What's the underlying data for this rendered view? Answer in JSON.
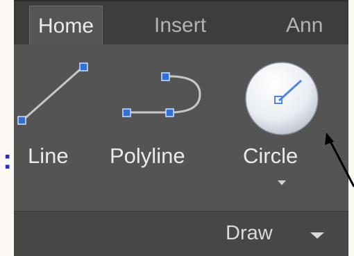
{
  "ribbon": {
    "tabs": [
      {
        "label": "Home",
        "active": true
      },
      {
        "label": "Insert",
        "active": false
      },
      {
        "label": "Ann",
        "active": false
      }
    ],
    "tools": [
      {
        "label": "Line",
        "icon": "line-icon"
      },
      {
        "label": "Polyline",
        "icon": "polyline-icon"
      },
      {
        "label": "Circle",
        "icon": "circle-icon",
        "has_dropdown": true
      }
    ],
    "panel_title": "Draw"
  },
  "annotation": {
    "left_mark": ":"
  },
  "colors": {
    "accent_blue": "#2f6fd6",
    "panel_bg": "#545454",
    "tabbar_bg": "#3d3d3d",
    "footer_bg": "#474747"
  }
}
